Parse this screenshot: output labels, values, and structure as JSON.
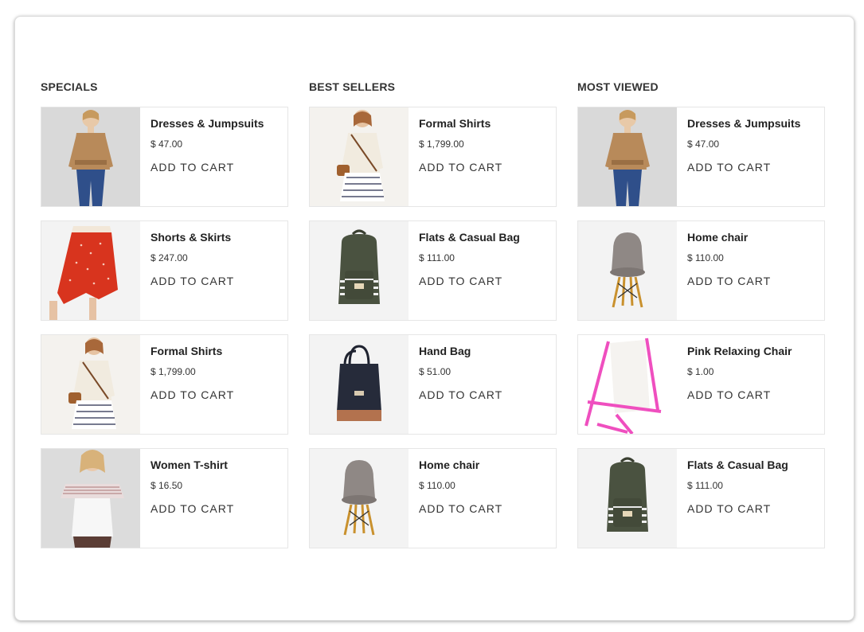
{
  "columns": [
    {
      "title": "SPECIALS",
      "products": [
        {
          "name": "Dresses & Jumpsuits",
          "price": "$ 47.00",
          "cta": "ADD TO CART",
          "image": "woman-tan-blouse"
        },
        {
          "name": "Shorts & Skirts",
          "price": "$ 247.00",
          "cta": "ADD TO CART",
          "image": "red-polka-skirt"
        },
        {
          "name": "Formal Shirts",
          "price": "$ 1,799.00",
          "cta": "ADD TO CART",
          "image": "woman-striped-skirt"
        },
        {
          "name": "Women T-shirt",
          "price": "$ 16.50",
          "cta": "ADD TO CART",
          "image": "woman-off-shoulder-top"
        }
      ]
    },
    {
      "title": "BEST SELLERS",
      "products": [
        {
          "name": "Formal Shirts",
          "price": "$ 1,799.00",
          "cta": "ADD TO CART",
          "image": "woman-striped-skirt"
        },
        {
          "name": "Flats & Casual Bag",
          "price": "$ 111.00",
          "cta": "ADD TO CART",
          "image": "green-backpack"
        },
        {
          "name": "Hand Bag",
          "price": "$ 51.00",
          "cta": "ADD TO CART",
          "image": "black-tote-bag"
        },
        {
          "name": "Home chair",
          "price": "$ 110.00",
          "cta": "ADD TO CART",
          "image": "grey-chair"
        }
      ]
    },
    {
      "title": "MOST VIEWED",
      "products": [
        {
          "name": "Dresses & Jumpsuits",
          "price": "$ 47.00",
          "cta": "ADD TO CART",
          "image": "woman-tan-blouse"
        },
        {
          "name": "Home chair",
          "price": "$ 110.00",
          "cta": "ADD TO CART",
          "image": "grey-chair"
        },
        {
          "name": "Pink Relaxing Chair",
          "price": "$ 1.00",
          "cta": "ADD TO CART",
          "image": "pink-deck-chair"
        },
        {
          "name": "Flats & Casual Bag",
          "price": "$ 111.00",
          "cta": "ADD TO CART",
          "image": "green-backpack"
        }
      ]
    }
  ]
}
